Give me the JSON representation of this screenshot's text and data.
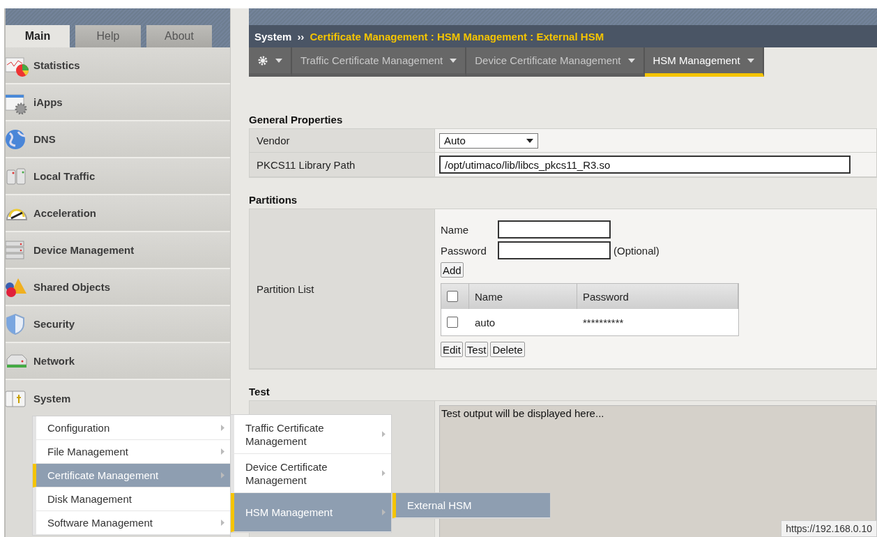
{
  "top_tabs": [
    {
      "label": "Main",
      "selected": true
    },
    {
      "label": "Help",
      "selected": false
    },
    {
      "label": "About",
      "selected": false
    }
  ],
  "nav": [
    {
      "label": "Statistics",
      "selected": false
    },
    {
      "label": "iApps",
      "selected": false
    },
    {
      "label": "DNS",
      "selected": false
    },
    {
      "label": "Local Traffic",
      "selected": false
    },
    {
      "label": "Acceleration",
      "selected": false
    },
    {
      "label": "Device Management",
      "selected": false
    },
    {
      "label": "Shared Objects",
      "selected": false
    },
    {
      "label": "Security",
      "selected": false
    },
    {
      "label": "Network",
      "selected": false
    },
    {
      "label": "System",
      "selected": true
    }
  ],
  "breadcrumb": {
    "root": "System",
    "separator": "››",
    "path": "Certificate Management : HSM Management : External HSM"
  },
  "subnav": [
    {
      "label": "Traffic Certificate Management",
      "selected": false
    },
    {
      "label": "Device Certificate Management",
      "selected": false
    },
    {
      "label": "HSM Management",
      "selected": true
    }
  ],
  "general_properties": {
    "title": "General Properties",
    "rows": [
      {
        "label": "Vendor",
        "kind": "select",
        "value": "Auto"
      },
      {
        "label": "PKCS11 Library Path",
        "kind": "text",
        "value": "/opt/utimaco/lib/libcs_pkcs11_R3.so"
      }
    ]
  },
  "partitions": {
    "title": "Partitions",
    "row_label": "Partition List",
    "name_label": "Name",
    "password_label": "Password",
    "optional_note": "(Optional)",
    "add_button": "Add",
    "header_checked": false,
    "columns": [
      "Name",
      "Password"
    ],
    "rows": [
      {
        "name": "auto",
        "password": "**********",
        "checked": false
      }
    ],
    "buttons": [
      "Edit",
      "Test",
      "Delete"
    ]
  },
  "test": {
    "title": "Test",
    "output": "Test output will be displayed here..."
  },
  "system_menu": [
    {
      "label": "Configuration",
      "selected": false,
      "submenu": true
    },
    {
      "label": "File Management",
      "selected": false,
      "submenu": true
    },
    {
      "label": "Certificate Management",
      "selected": true,
      "submenu": true
    },
    {
      "label": "Disk Management",
      "selected": false,
      "submenu": false
    },
    {
      "label": "Software Management",
      "selected": false,
      "submenu": true
    }
  ],
  "certificate_menu": [
    {
      "label": "Traffic Certificate Management",
      "selected": false,
      "submenu": true
    },
    {
      "label": "Device Certificate Management",
      "selected": false,
      "submenu": true
    },
    {
      "label": "HSM Management",
      "selected": true,
      "submenu": true
    }
  ],
  "hsm_menu": [
    {
      "label": "External HSM",
      "selected": true,
      "submenu": false
    }
  ],
  "status_url": "https://192.168.0.10"
}
